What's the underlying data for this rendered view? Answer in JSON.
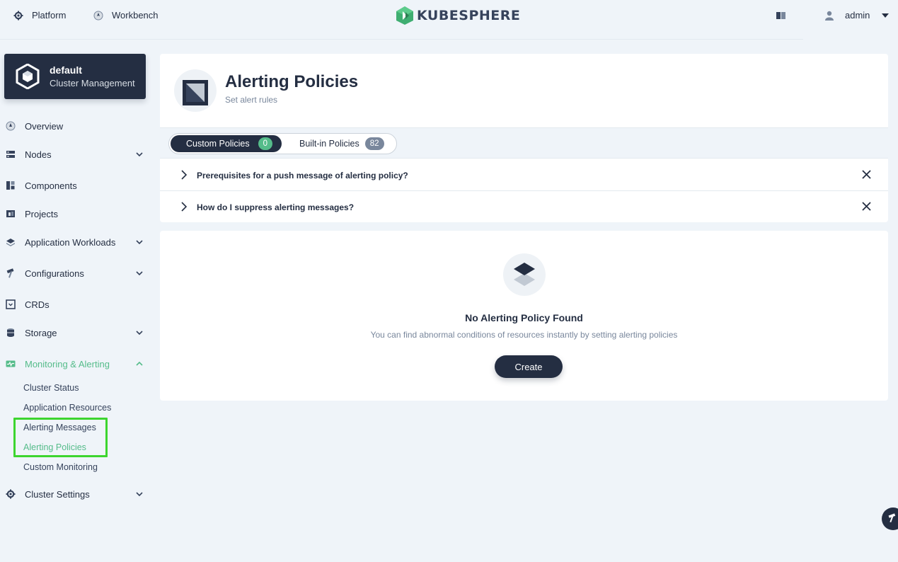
{
  "topbar": {
    "platform_label": "Platform",
    "workbench_label": "Workbench",
    "logo_text": "KUBESPHERE",
    "user_name": "admin"
  },
  "cluster": {
    "name": "default",
    "subtitle": "Cluster Management"
  },
  "sidebar": {
    "items": [
      {
        "label": "Overview"
      },
      {
        "label": "Nodes"
      },
      {
        "label": "Components"
      },
      {
        "label": "Projects"
      },
      {
        "label": "Application Workloads"
      },
      {
        "label": "Configurations"
      },
      {
        "label": "CRDs"
      },
      {
        "label": "Storage"
      },
      {
        "label": "Monitoring & Alerting"
      },
      {
        "label": "Cluster Settings"
      }
    ],
    "monitoring_sub": [
      {
        "label": "Cluster Status"
      },
      {
        "label": "Application Resources"
      },
      {
        "label": "Alerting Messages"
      },
      {
        "label": "Alerting Policies"
      },
      {
        "label": "Custom Monitoring"
      }
    ]
  },
  "page": {
    "title": "Alerting Policies",
    "description": "Set alert rules"
  },
  "tabs": [
    {
      "label": "Custom Policies",
      "count": "0"
    },
    {
      "label": "Built-in Policies",
      "count": "82"
    }
  ],
  "faq": [
    {
      "question": "Prerequisites for a push message of alerting policy?"
    },
    {
      "question": "How do I suppress alerting messages?"
    }
  ],
  "empty": {
    "title": "No Alerting Policy Found",
    "description": "You can find abnormal conditions of resources instantly by setting alerting policies",
    "create_label": "Create"
  },
  "colors": {
    "accent_green": "#55bc8a",
    "dark": "#242e42",
    "highlight_box": "#3dd52f"
  }
}
